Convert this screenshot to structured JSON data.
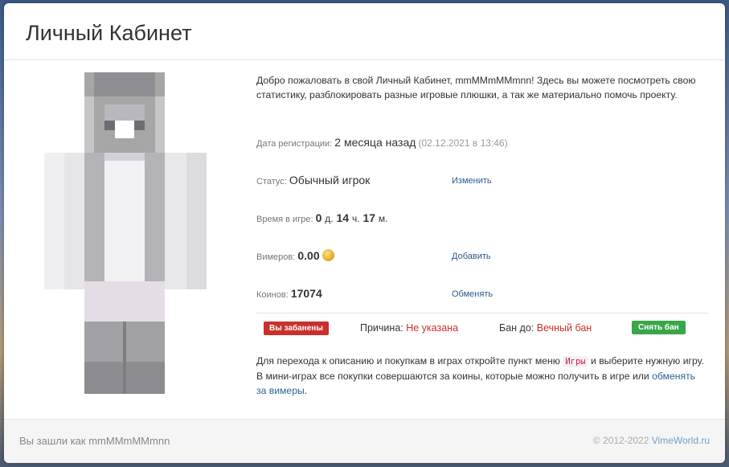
{
  "header": {
    "title": "Личный Кабинет"
  },
  "info": {
    "welcome": "Добро пожаловать в свой Личный Кабинет, mmMMmMMmnn! Здесь вы можете посмотреть свою статистику, разблокировать разные игровые плюшки, а так же материально помочь проекту.",
    "registration": {
      "label": "Дата регистрации:",
      "value": "2 месяца назад",
      "date": "(02.12.2021 в 13:46)"
    },
    "status": {
      "label": "Статус:",
      "value": "Обычный игрок",
      "action": "Изменить"
    },
    "playtime": {
      "label": "Время в игре:",
      "days": "0",
      "days_unit": "д.",
      "hours": "14",
      "hours_unit": "ч.",
      "minutes": "17",
      "minutes_unit": "м."
    },
    "vimers": {
      "label": "Вимеров:",
      "value": "0.00",
      "action": "Добавить",
      "icon": "coin-icon"
    },
    "coins": {
      "label": "Коинов:",
      "value": "17074",
      "action": "Обменять"
    }
  },
  "ban": {
    "badge": "Вы забанены",
    "reason_label": "Причина:",
    "reason_value": "Не указана",
    "until_label": "Бан до:",
    "until_value": "Вечный бан",
    "unban_button": "Снять бан"
  },
  "note": {
    "part1": "Для перехода к описанию и покупкам в играх откройте пункт меню ",
    "menu_item": "Игры",
    "part2": " и выберите нужную игру. В мини-играх все покупки совершаются за коины, которые можно получить в игре или ",
    "link": "обменять за вимеры",
    "part3": "."
  },
  "footer": {
    "logged_in": "Вы зашли как mmMMmMMmnn",
    "copyright": "© 2012-2022 ",
    "site": "VimeWorld.ru"
  },
  "colors": {
    "danger": "#c9302c",
    "success": "#3aa64a",
    "link": "#2a5a8f"
  }
}
